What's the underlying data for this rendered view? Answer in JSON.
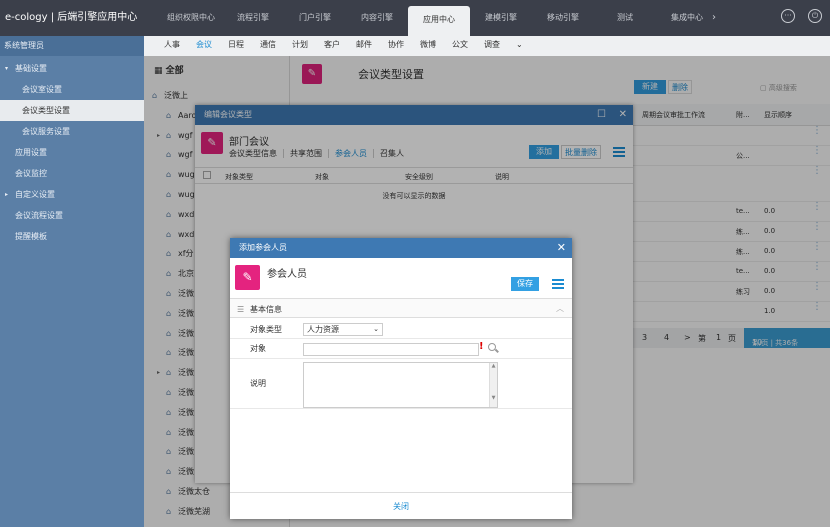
{
  "app": {
    "title": "e-cology | 后端引擎应用中心"
  },
  "top_tabs": [
    "组织权限中心",
    "流程引擎",
    "门户引擎",
    "内容引擎",
    "应用中心",
    "建模引擎",
    "移动引擎",
    "测试",
    "集成中心"
  ],
  "top_active_tab": "应用中心",
  "sidebar": {
    "header": "系统管理员",
    "items": [
      {
        "label": "基础设置",
        "level": 0,
        "expanded": true
      },
      {
        "label": "会议室设置",
        "level": 1
      },
      {
        "label": "会议类型设置",
        "level": 1,
        "active": true
      },
      {
        "label": "会议服务设置",
        "level": 1
      },
      {
        "label": "应用设置",
        "level": 0
      },
      {
        "label": "会议监控",
        "level": 0
      },
      {
        "label": "自定义设置",
        "level": 0,
        "collapsed": true
      },
      {
        "label": "会议流程设置",
        "level": 0
      },
      {
        "label": "提醒模板",
        "level": 0
      }
    ]
  },
  "sub_nav": [
    "人事",
    "会议",
    "日程",
    "通信",
    "计划",
    "客户",
    "邮件",
    "协作",
    "微博",
    "公文",
    "调查"
  ],
  "sub_nav_active": "会议",
  "tree": {
    "header": "全部",
    "items": [
      "泛微上",
      "Aaro",
      "wgf",
      "wgf",
      "wug",
      "wug",
      "wxd",
      "wxd",
      "xf分",
      "北京",
      "泛微",
      "泛微",
      "泛微",
      "泛微",
      "泛微",
      "泛微",
      "泛微",
      "泛微",
      "泛微",
      "泛微",
      "泛微太仓",
      "泛微芜湖"
    ]
  },
  "content": {
    "title": "会议类型设置",
    "new_label": "新建",
    "delete_label": "删除",
    "search_label": "高级搜索",
    "col_approval": "周期会议审批工作流",
    "col_attach": "附...",
    "col_order": "显示顺序",
    "rows": [
      {
        "attach": "",
        "order": ""
      },
      {
        "attach": "公...",
        "order": ""
      },
      {
        "attach": "",
        "order": ""
      },
      {
        "attach": "te...",
        "order": "0.0"
      },
      {
        "attach": "练...",
        "order": "0.0"
      },
      {
        "attach": "练...",
        "order": "0.0"
      },
      {
        "attach": "te...",
        "order": "0.0"
      },
      {
        "attach": "练习",
        "order": "0.0"
      },
      {
        "attach": "",
        "order": "1.0"
      }
    ],
    "pager": {
      "p3": "3",
      "p4": "4",
      "next": ">",
      "goto": "第",
      "page": "1",
      "page_unit": "页",
      "size": "10",
      "info": "条/页 | 共36条"
    }
  },
  "dialog1": {
    "title": "编辑会议类型",
    "name": "部门会议",
    "tabs": [
      "会议类型信息",
      "共享范围",
      "参会人员",
      "召集人"
    ],
    "active_tab": "参会人员",
    "add_label": "添加",
    "batch_delete_label": "批量删除",
    "columns": [
      "对象类型",
      "对象",
      "安全级别",
      "说明"
    ],
    "empty_message": "没有可以显示的数据"
  },
  "dialog2": {
    "title": "添加参会人员",
    "name": "参会人员",
    "save_label": "保存",
    "section_label": "基本信息",
    "fields": {
      "object_type_label": "对象类型",
      "object_type_value": "人力资源",
      "object_label": "对象",
      "object_value": "",
      "description_label": "说明",
      "description_value": ""
    },
    "close_label": "关闭"
  },
  "colors": {
    "accent": "#33a0e3",
    "topbar": "#3b3f4a",
    "sidebar": "#5b7fa6",
    "dialog_title": "#3e79b3",
    "icon_pink": "#e4237f"
  }
}
